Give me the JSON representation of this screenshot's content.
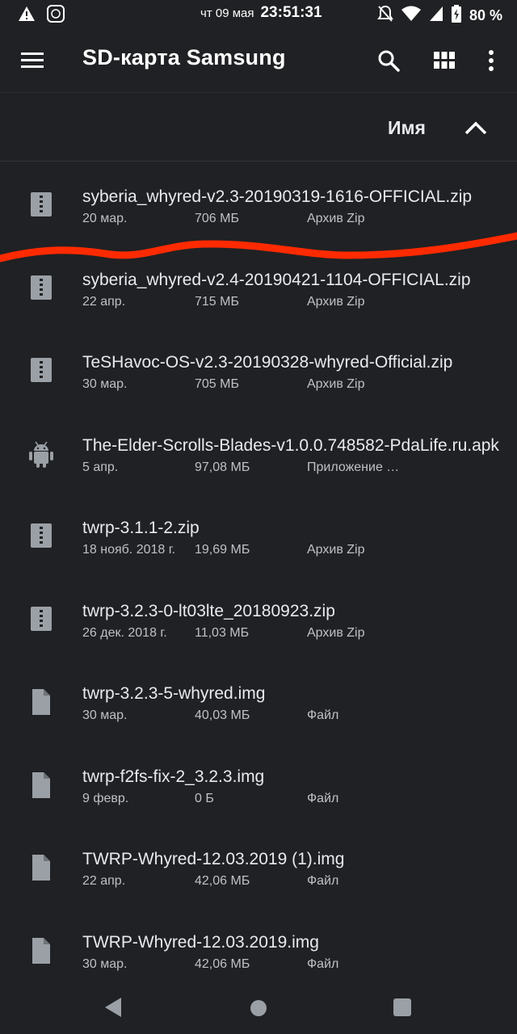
{
  "status_bar": {
    "date": "чт 09 мая",
    "time": "23:51:31",
    "battery": "80 %",
    "icons": [
      "warning-icon",
      "app-notification-icon",
      "mute-icon",
      "wifi-icon",
      "signal-icon",
      "battery-charging-icon"
    ]
  },
  "app_bar": {
    "title": "SD-карта Samsung",
    "icons": [
      "menu-icon",
      "search-icon",
      "grid-view-icon",
      "more-vert-icon"
    ]
  },
  "sort": {
    "label": "Имя",
    "direction_icon": "chevron-up-icon"
  },
  "files": [
    {
      "name": "syberia_whyred-v2.3-20190319-1616-OFFICIAL.zip",
      "date": "20 мар.",
      "size": "706 МБ",
      "type": "Архив Zip",
      "icon": "zip-icon"
    },
    {
      "name": "syberia_whyred-v2.4-20190421-1104-OFFICIAL.zip",
      "date": "22 апр.",
      "size": "715 МБ",
      "type": "Архив Zip",
      "icon": "zip-icon"
    },
    {
      "name": "TeSHavoc-OS-v2.3-20190328-whyred-Official.zip",
      "date": "30 мар.",
      "size": "705 МБ",
      "type": "Архив Zip",
      "icon": "zip-icon"
    },
    {
      "name": "The-Elder-Scrolls-Blades-v1.0.0.748582-PdaLife.ru.apk",
      "date": "5 апр.",
      "size": "97,08 МБ",
      "type": "Приложение Android",
      "icon": "android-icon"
    },
    {
      "name": "twrp-3.1.1-2.zip",
      "date": "18 нояб. 2018 г.",
      "size": "19,69 МБ",
      "type": "Архив Zip",
      "icon": "zip-icon"
    },
    {
      "name": "twrp-3.2.3-0-lt03lte_20180923.zip",
      "date": "26 дек. 2018 г.",
      "size": "11,03 МБ",
      "type": "Архив Zip",
      "icon": "zip-icon"
    },
    {
      "name": "twrp-3.2.3-5-whyred.img",
      "date": "30 мар.",
      "size": "40,03 МБ",
      "type": "Файл",
      "icon": "file-icon"
    },
    {
      "name": "twrp-f2fs-fix-2_3.2.3.img",
      "date": "9 февр.",
      "size": "0 Б",
      "type": "Файл",
      "icon": "file-icon"
    },
    {
      "name": "TWRP-Whyred-12.03.2019 (1).img",
      "date": "22 апр.",
      "size": "42,06 МБ",
      "type": "Файл",
      "icon": "file-icon"
    },
    {
      "name": "TWRP-Whyred-12.03.2019.img",
      "date": "30 мар.",
      "size": "42,06 МБ",
      "type": "Файл",
      "icon": "file-icon"
    }
  ],
  "colors": {
    "background": "#202124",
    "text_primary": "#e8eaed",
    "text_secondary": "#bdc1c6",
    "icon": "#9aa0a6",
    "annotation": "#ff2a00"
  },
  "nav_bar": {
    "icons": [
      "back-icon",
      "home-icon",
      "recents-icon"
    ]
  }
}
